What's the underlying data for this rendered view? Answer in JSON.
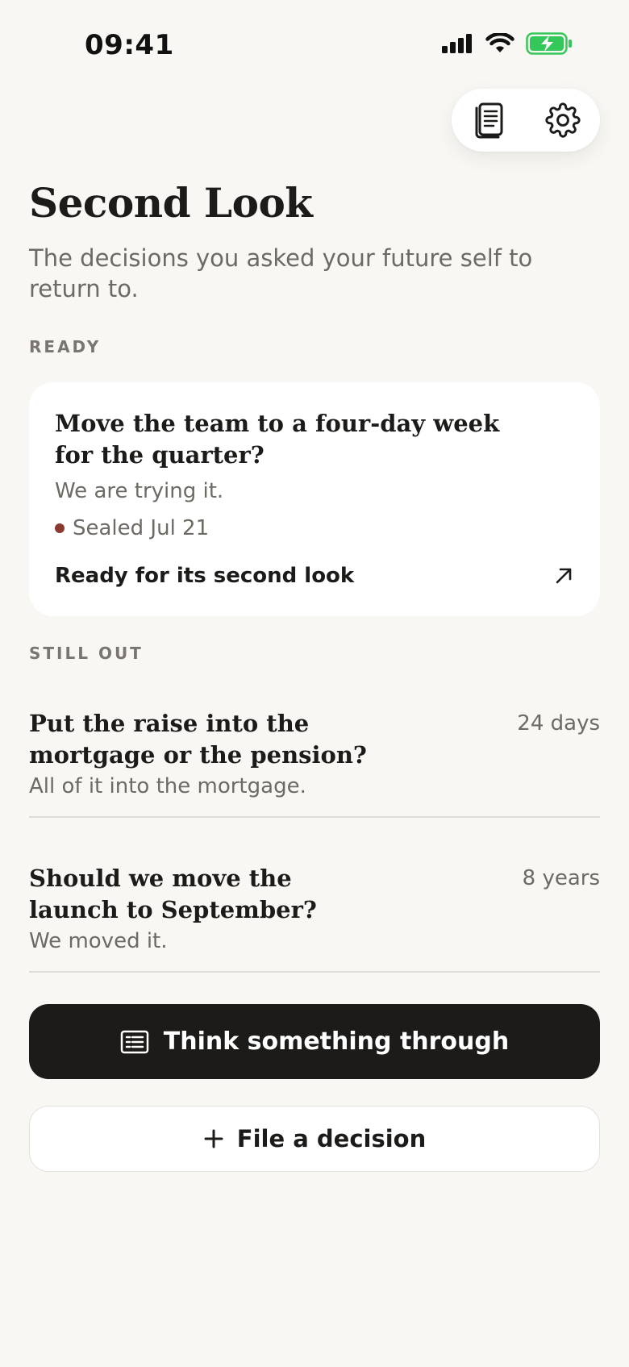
{
  "status_bar": {
    "time": "09:41",
    "icons": [
      "signal-icon",
      "wifi-icon",
      "battery-charging-icon"
    ]
  },
  "toolbar": {
    "icons": [
      "journal-icon",
      "gear-icon"
    ]
  },
  "header": {
    "title": "Second Look",
    "subtitle": "The decisions you asked your future self to return to."
  },
  "ready": {
    "section_label": "READY",
    "card": {
      "title": "Move the team to a four-day week for the quarter?",
      "note": "We are trying it.",
      "sealed": "Sealed Jul 21",
      "sealed_dot_color": "#8a3a2f",
      "action_label": "Ready for its second look",
      "action_icon": "arrow-up-right-icon"
    }
  },
  "still_out": {
    "section_label": "STILL OUT",
    "items": [
      {
        "title": "Put the raise into the mortgage or the pension?",
        "note": "All of it into the mortgage.",
        "time": "24 days"
      },
      {
        "title": "Should we move the launch to September?",
        "note": "We moved it.",
        "time": "8 years"
      }
    ]
  },
  "actions": {
    "primary": {
      "label": "Think something through",
      "icon": "notes-icon"
    },
    "secondary": {
      "label": "File a decision",
      "icon": "plus-icon"
    }
  },
  "colors": {
    "background": "#f8f7f3",
    "primary_button": "#1c1b19",
    "text": "#1c1b19",
    "muted_text": "#6d6a64",
    "battery": "#34c759"
  }
}
